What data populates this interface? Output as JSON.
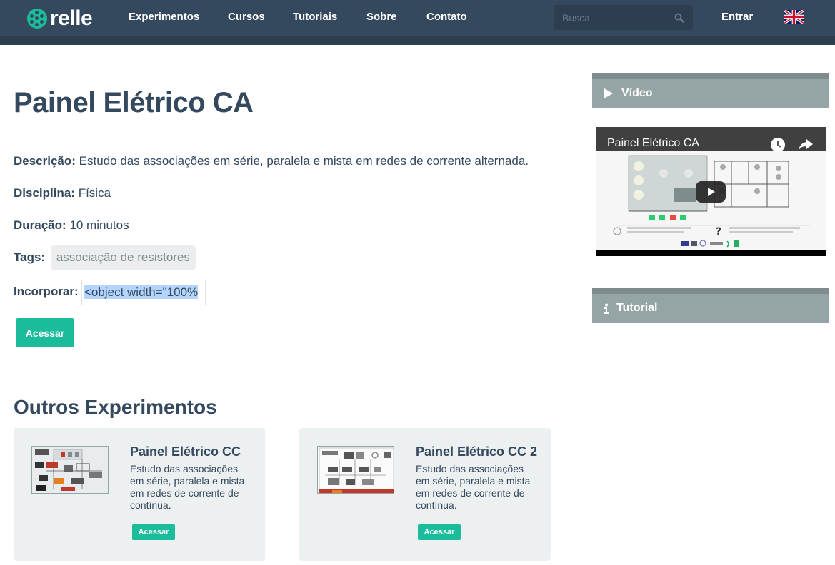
{
  "brand": {
    "name": "relle"
  },
  "nav": {
    "items": [
      {
        "label": "Experimentos"
      },
      {
        "label": "Cursos"
      },
      {
        "label": "Tutoriais"
      },
      {
        "label": "Sobre"
      },
      {
        "label": "Contato"
      }
    ],
    "search_placeholder": "Busca",
    "login": "Entrar"
  },
  "experiment": {
    "title": "Painel Elétrico CA",
    "description_label": "Descrição:",
    "description": "Estudo das associações em série, paralela e mista em redes de corrente alternada.",
    "discipline_label": "Disciplina:",
    "discipline": "Física",
    "duration_label": "Duração:",
    "duration": "10 minutos",
    "tags_label": "Tags:",
    "tags": [
      "associação de resistores"
    ],
    "embed_label": "Incorporar:",
    "embed_code": "<object width=\"100%",
    "access_button": "Acessar"
  },
  "others": {
    "title": "Outros Experimentos",
    "cards": [
      {
        "title": "Painel Elétrico CC",
        "description": "Estudo das associações em série, paralela e mista em redes de corrente de contínua.",
        "button": "Acessar"
      },
      {
        "title": "Painel Elétrico CC 2",
        "description": "Estudo das associações em série, paralela e mista em redes de corrente de contínua.",
        "button": "Acessar"
      }
    ]
  },
  "sidebar": {
    "video_panel": "Vídeo",
    "video_title": "Painel Elétrico CA",
    "tutorial_panel": "Tutorial"
  },
  "colors": {
    "navbar": "#34495e",
    "accent": "#1abc9c",
    "panel": "#95a5a6",
    "card": "#ecf0f1"
  }
}
